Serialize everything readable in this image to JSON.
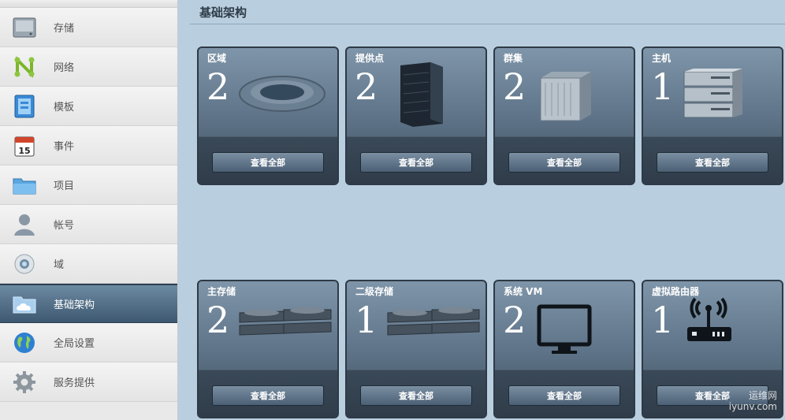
{
  "sidebar": {
    "items": [
      {
        "label": "存储",
        "icon": "storage-drive-icon"
      },
      {
        "label": "网络",
        "icon": "network-icon"
      },
      {
        "label": "模板",
        "icon": "template-icon"
      },
      {
        "label": "事件",
        "icon": "calendar-icon"
      },
      {
        "label": "项目",
        "icon": "folder-icon"
      },
      {
        "label": "帐号",
        "icon": "user-icon"
      },
      {
        "label": "域",
        "icon": "domain-icon"
      },
      {
        "label": "基础架构",
        "icon": "cloud-folder-icon"
      },
      {
        "label": "全局设置",
        "icon": "globe-icon"
      },
      {
        "label": "服务提供",
        "icon": "gear-icon"
      }
    ],
    "active_index": 7
  },
  "main": {
    "title": "基础架构",
    "cards": [
      {
        "title": "区域",
        "count": "2",
        "icon": "zone-ring-icon",
        "button": "查看全部"
      },
      {
        "title": "提供点",
        "count": "2",
        "icon": "pod-rack-icon",
        "button": "查看全部"
      },
      {
        "title": "群集",
        "count": "2",
        "icon": "cluster-box-icon",
        "button": "查看全部"
      },
      {
        "title": "主机",
        "count": "1",
        "icon": "host-server-icon",
        "button": "查看全部"
      },
      {
        "title": "主存储",
        "count": "2",
        "icon": "primary-storage-icon",
        "button": "查看全部"
      },
      {
        "title": "二级存储",
        "count": "1",
        "icon": "secondary-storage-icon",
        "button": "查看全部"
      },
      {
        "title": "系统 VM",
        "count": "2",
        "icon": "monitor-icon",
        "button": "查看全部"
      },
      {
        "title": "虚拟路由器",
        "count": "1",
        "icon": "router-icon",
        "button": "查看全部"
      }
    ]
  },
  "watermark": {
    "line1": "运维网",
    "line2": "iyunv.com"
  }
}
